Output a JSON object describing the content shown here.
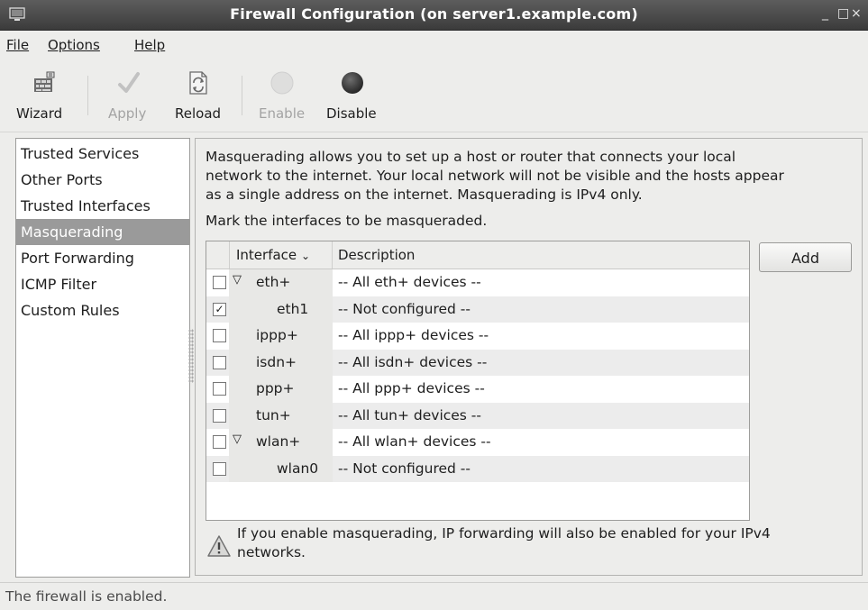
{
  "window": {
    "title": "Firewall Configuration (on server1.example.com)",
    "minimize": "_",
    "maximize": "□",
    "close": "×"
  },
  "menu": [
    {
      "label": "File"
    },
    {
      "label": "Options"
    },
    {
      "label": "Help"
    }
  ],
  "toolbar": {
    "wizard": {
      "label": "Wizard",
      "icon": "wizard-icon"
    },
    "apply": {
      "label": "Apply",
      "icon": "checkmark-icon",
      "enabled": false
    },
    "reload": {
      "label": "Reload",
      "icon": "reload-icon"
    },
    "enable": {
      "label": "Enable",
      "icon": "enable-circle-icon",
      "enabled": false
    },
    "disable": {
      "label": "Disable",
      "icon": "disable-circle-icon"
    }
  },
  "sidebar": {
    "items": [
      {
        "label": "Trusted Services"
      },
      {
        "label": "Other Ports"
      },
      {
        "label": "Trusted Interfaces"
      },
      {
        "label": "Masquerading",
        "selected": true
      },
      {
        "label": "Port Forwarding"
      },
      {
        "label": "ICMP Filter"
      },
      {
        "label": "Custom Rules"
      }
    ]
  },
  "main": {
    "description_lines": [
      "Masquerading allows you to set up a host or router that connects your local",
      "network to the internet. Your local network will not be visible and the hosts appear",
      "as a single address on the internet. Masquerading is IPv4 only."
    ],
    "mark_label": "Mark the interfaces to be masqueraded.",
    "table": {
      "col_interface": "Interface",
      "col_description": "Description",
      "rows": [
        {
          "interface": "eth+",
          "description": "-- All eth+ devices --",
          "checked": false,
          "expander": "▽"
        },
        {
          "interface": "eth1",
          "description": "-- Not configured --",
          "checked": true,
          "expander": ""
        },
        {
          "interface": "ippp+",
          "description": "-- All ippp+ devices --",
          "checked": false,
          "expander": ""
        },
        {
          "interface": "isdn+",
          "description": "-- All isdn+ devices --",
          "checked": false,
          "expander": ""
        },
        {
          "interface": "ppp+",
          "description": "-- All ppp+ devices --",
          "checked": false,
          "expander": ""
        },
        {
          "interface": "tun+",
          "description": "-- All tun+ devices --",
          "checked": false,
          "expander": ""
        },
        {
          "interface": "wlan+",
          "description": "-- All wlan+ devices --",
          "checked": false,
          "expander": "▽"
        },
        {
          "interface": "wlan0",
          "description": "-- Not configured --",
          "checked": false,
          "expander": ""
        }
      ]
    },
    "add_button": "Add",
    "warning_lines": [
      "If you enable masquerading, IP forwarding will also be enabled for your IPv4",
      "networks."
    ]
  },
  "status": "The firewall is enabled."
}
